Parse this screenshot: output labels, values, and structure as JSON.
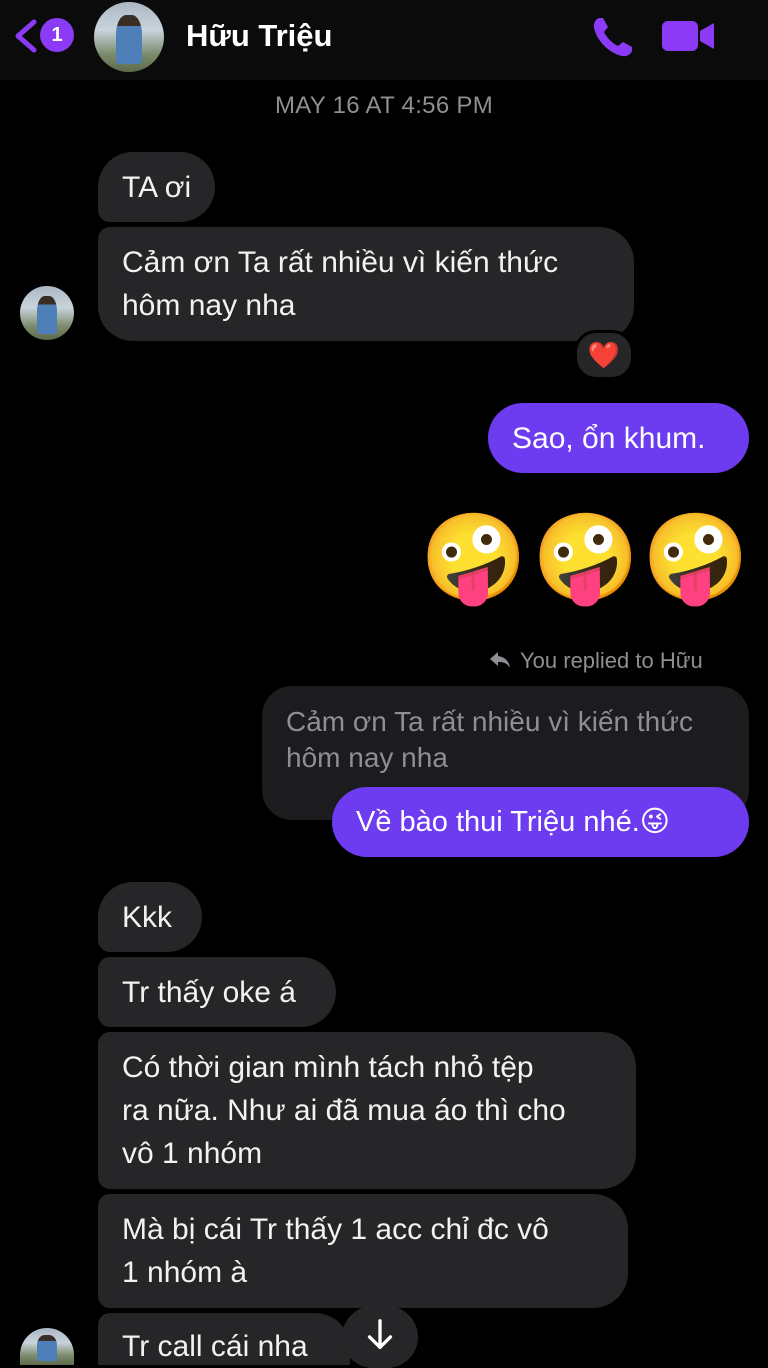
{
  "header": {
    "back_badge": "1",
    "contact_name": "Hữu Triệu",
    "icons": {
      "back": "chevron-left-icon",
      "call": "phone-icon",
      "video": "video-camera-icon"
    },
    "accent_color": "#8b3bf6"
  },
  "conversation": {
    "timestamp": "MAY 16 AT 4:56 PM",
    "messages_a": [
      {
        "text": "TA ơi"
      },
      {
        "line1": "Cảm ơn Ta rất nhiều vì kiến thức",
        "line2": "hôm nay nha",
        "reaction": "❤️"
      }
    ],
    "my_reply": "Sao, ổn khum.",
    "my_emojis": [
      "🤪",
      "🤪",
      "🤪"
    ],
    "reply_note": "You replied to Hữu",
    "quoted": {
      "line1": "Cảm ơn Ta rất nhiều vì kiến thức",
      "line2": "hôm nay nha"
    },
    "my_reply_2": "Về bào thui Triệu nhé.",
    "my_reply_2_emoji": "😜",
    "messages_b": [
      {
        "text": "Kkk"
      },
      {
        "text": "Tr thấy oke á"
      },
      {
        "line1": "Có thời gian mình tách nhỏ tệp",
        "line2": "ra nữa. Như ai đã mua áo thì cho",
        "line3": "vô 1 nhóm"
      },
      {
        "line1": "Mà bị cái Tr thấy 1 acc chỉ đc vô",
        "line2": "1 nhóm à"
      },
      {
        "text": "Tr call cái nha"
      }
    ],
    "scroll_icon": "arrow-down-icon",
    "bubble_color_other": "#262628",
    "bubble_color_me": "#6d3bf0"
  }
}
